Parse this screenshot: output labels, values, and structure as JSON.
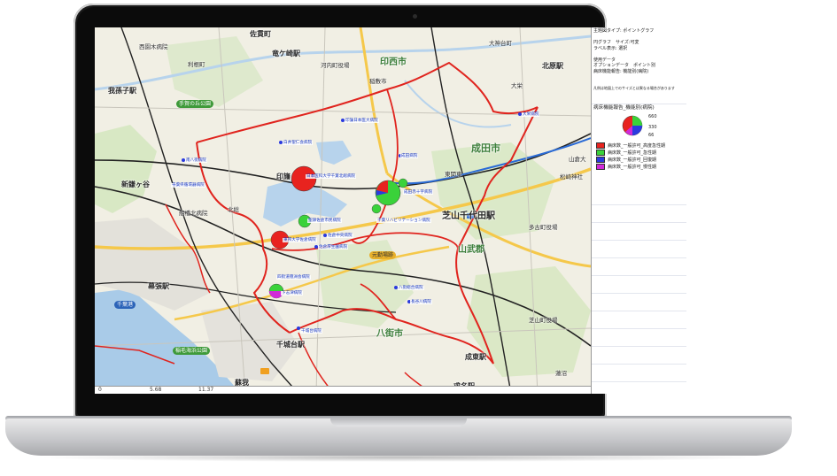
{
  "panel": {
    "lines_top": [
      "主題図タイプ: ポイントグラフ",
      "",
      "円グラフ　サイズ:可変",
      "ラベル表示: 選択",
      "",
      "使用データ",
      "オプションデータ　ポイント別",
      "病床機能報告: 機能別(病院)",
      "",
      "",
      "凡例は地図上でのサイズとは異なる場合があります"
    ],
    "legend_title": "病床機能報告_機能別(病院)",
    "legend_sizes": [
      "660",
      "330",
      "66"
    ],
    "legend_items": [
      {
        "label": "病床数_一般許可_高度急性期",
        "color": "#e8231f"
      },
      {
        "label": "病床数_一般許可_急性期",
        "color": "#3ad23a"
      },
      {
        "label": "病床数_一般許可_回復期",
        "color": "#2a3adf"
      },
      {
        "label": "病床数_一般許可_慢性期",
        "color": "#d02ad8"
      }
    ]
  },
  "scale_bar": {
    "ticks": [
      "0",
      "5.68",
      "11.37"
    ]
  },
  "places": [
    {
      "name": "佐貫町",
      "size": "lg"
    },
    {
      "name": "竜ケ崎駅",
      "size": "lg"
    },
    {
      "name": "大神台町",
      "size": "sm"
    },
    {
      "name": "北原駅",
      "size": "lg"
    },
    {
      "name": "西園木病院",
      "size": "sm"
    },
    {
      "name": "我孫子駅",
      "size": "lg"
    },
    {
      "name": "手賀の丘公園",
      "size": "sm"
    },
    {
      "name": "印西市",
      "size": "lg"
    },
    {
      "name": "成田市",
      "size": "lg"
    },
    {
      "name": "印旛",
      "size": "lg"
    },
    {
      "name": "芝山千代田駅",
      "size": "lg"
    },
    {
      "name": "山武郡",
      "size": "lg"
    },
    {
      "name": "八街市",
      "size": "lg"
    },
    {
      "name": "千城台駅",
      "size": "lg"
    },
    {
      "name": "千葉港",
      "size": "sm"
    },
    {
      "name": "稲毛海浜公園",
      "size": "sm"
    },
    {
      "name": "成東駅",
      "size": "lg"
    },
    {
      "name": "求名駅",
      "size": "lg"
    },
    {
      "name": "元勤場跡",
      "size": "sm"
    },
    {
      "name": "多古町役場",
      "size": "sm"
    },
    {
      "name": "芝山町役場",
      "size": "sm"
    },
    {
      "name": "山倉大",
      "size": "sm"
    },
    {
      "name": "松崎神社",
      "size": "sm"
    },
    {
      "name": "蓮沼",
      "size": "sm"
    },
    {
      "name": "北総",
      "size": "sm"
    },
    {
      "name": "東関東",
      "size": "sm"
    },
    {
      "name": "大栄",
      "size": "sm"
    },
    {
      "name": "蘇我",
      "size": "lg"
    },
    {
      "name": "幕張駅",
      "size": "lg"
    },
    {
      "name": "新鎌ヶ谷",
      "size": "lg"
    },
    {
      "name": "船橋北病院",
      "size": "sm"
    },
    {
      "name": "河内町役場",
      "size": "sm"
    },
    {
      "name": "稲敷市",
      "size": "lg"
    },
    {
      "name": "利根町",
      "size": "sm"
    }
  ],
  "hospitals": [
    {
      "label": "日本医科大学千葉北総病院"
    },
    {
      "label": "成田赤十字病院"
    },
    {
      "label": "聖隷佐倉市民病院"
    },
    {
      "label": "東邦大学佐倉病院"
    },
    {
      "label": "千葉リハビリテーション病院"
    },
    {
      "label": "四街道徳洲会病院"
    },
    {
      "label": "下志津病院"
    },
    {
      "label": "千城台病院"
    },
    {
      "label": "八街総合病院"
    },
    {
      "label": "成田病院"
    },
    {
      "label": "長谷川病院"
    },
    {
      "label": "白井聖仁会病院"
    },
    {
      "label": "大栄病院"
    },
    {
      "label": "印旛日本医大病院"
    },
    {
      "label": "佐倉中央病院"
    },
    {
      "label": "佐倉厚生園病院"
    },
    {
      "label": "南八街病院"
    },
    {
      "label": "千葉県循環器病院"
    }
  ]
}
